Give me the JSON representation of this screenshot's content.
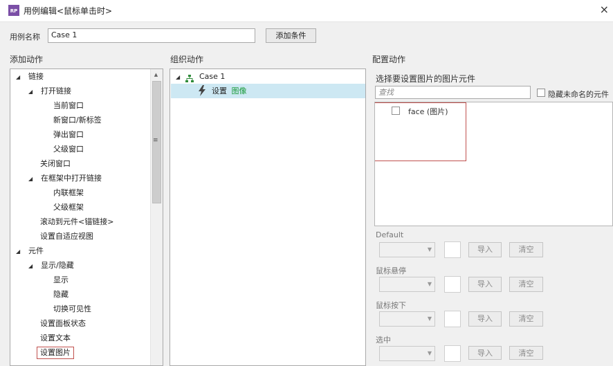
{
  "window": {
    "title": "用例编辑<鼠标单击时>",
    "app_icon": "RP",
    "close": "×"
  },
  "case_name": {
    "label": "用例名称",
    "value": "Case 1",
    "add_condition": "添加条件"
  },
  "sections": {
    "add_actions": "添加动作",
    "organize_actions": "组织动作",
    "configure_actions": "配置动作"
  },
  "add_tree": [
    {
      "label": "链接",
      "arrow": "◢"
    },
    {
      "label": "打开链接",
      "arrow": "◢"
    },
    {
      "label": "当前窗口"
    },
    {
      "label": "新窗口/新标签"
    },
    {
      "label": "弹出窗口"
    },
    {
      "label": "父级窗口"
    },
    {
      "label": "关闭窗口"
    },
    {
      "label": "在框架中打开链接",
      "arrow": "◢"
    },
    {
      "label": "内联框架"
    },
    {
      "label": "父级框架"
    },
    {
      "label": "滚动到元件<锚链接>"
    },
    {
      "label": "设置自适应视图"
    },
    {
      "label": "元件",
      "arrow": "◢"
    },
    {
      "label": "显示/隐藏",
      "arrow": "◢"
    },
    {
      "label": "显示"
    },
    {
      "label": "隐藏"
    },
    {
      "label": "切换可见性"
    },
    {
      "label": "设置面板状态"
    },
    {
      "label": "设置文本"
    },
    {
      "label": "设置图片"
    }
  ],
  "organize": {
    "case_label": "Case 1",
    "action_prefix": "设置",
    "action_target": "图像"
  },
  "config": {
    "select_label": "选择要设置图片的图片元件",
    "search_placeholder": "查找",
    "hide_unnamed": "隐藏未命名的元件",
    "widget_item": "face (图片)",
    "states": [
      {
        "label": "Default"
      },
      {
        "label": "鼠标悬停"
      },
      {
        "label": "鼠标按下"
      },
      {
        "label": "选中"
      }
    ],
    "import": "导入",
    "clear": "清空"
  },
  "colors": {
    "selection": "#cde8f3",
    "highlight_border": "#c0504d",
    "accent_green": "#1a9a3a",
    "app_icon": "#7b4fa6"
  }
}
